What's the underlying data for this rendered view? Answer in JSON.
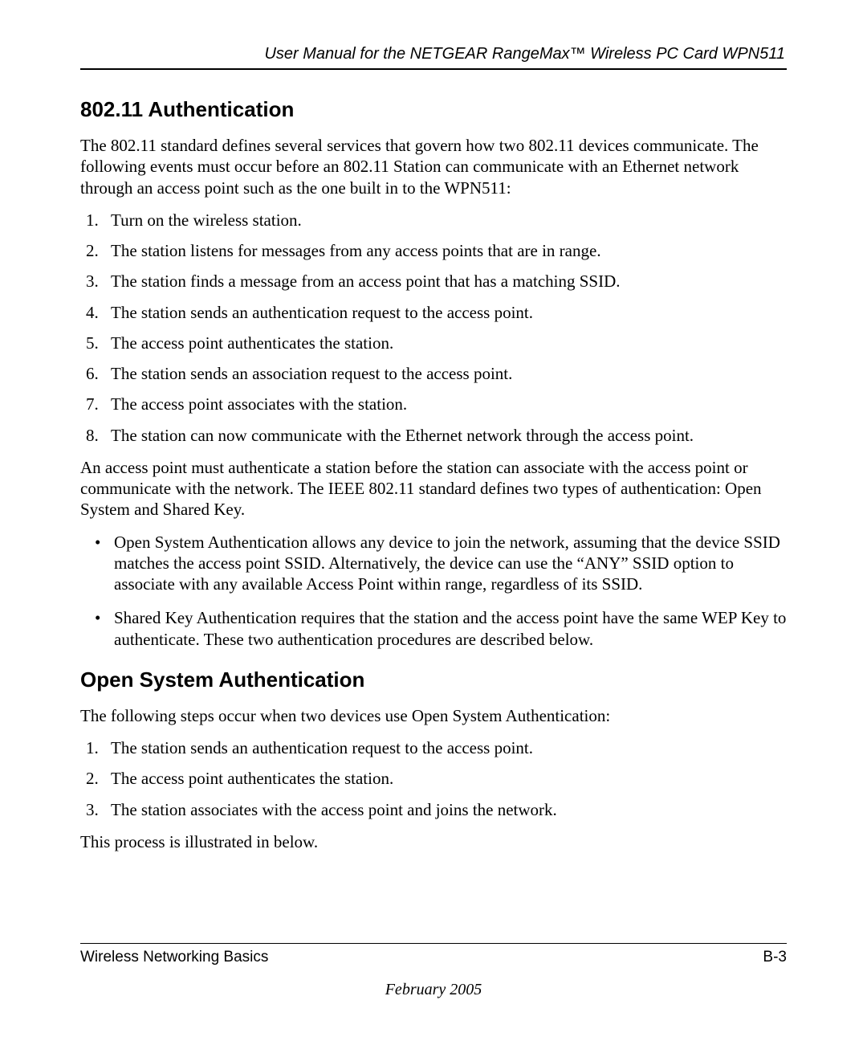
{
  "header": {
    "running_head": "User Manual for the NETGEAR RangeMax™ Wireless PC Card WPN511"
  },
  "section1": {
    "title": "802.11 Authentication",
    "intro": "The 802.11 standard defines several services that govern how two 802.11 devices communicate. The following events must occur before an 802.11 Station can communicate with an Ethernet network through an access point such as the one built in to the WPN511:",
    "steps": [
      "Turn on the wireless station.",
      "The station listens for messages from any access points that are in range.",
      "The station finds a message from an access point that has a matching SSID.",
      "The station sends an authentication request to the access point.",
      "The access point authenticates the station.",
      "The station sends an association request to the access point.",
      "The access point associates with the station.",
      "The station can now communicate with the Ethernet network through the access point."
    ],
    "para2": "An access point must authenticate a station before the station can associate with the access point or communicate with the network. The IEEE 802.11 standard defines two types of authentication: Open System and Shared Key.",
    "bullets": [
      "Open System Authentication allows any device to join the network, assuming that the device SSID matches the access point SSID. Alternatively, the device can use the “ANY” SSID option to associate with any available Access Point within range, regardless of its SSID.",
      "Shared Key Authentication requires that the station and the access point have the same WEP Key to authenticate. These two authentication procedures are described below."
    ]
  },
  "section2": {
    "title": "Open System Authentication",
    "intro": "The following steps occur when two devices use Open System Authentication:",
    "steps": [
      "The station sends an authentication request to the access point.",
      "The access point authenticates the station.",
      "The station associates with the access point and joins the network."
    ],
    "outro": "This process is illustrated in below."
  },
  "footer": {
    "left": "Wireless Networking Basics",
    "right": "B-3",
    "date": "February 2005"
  }
}
